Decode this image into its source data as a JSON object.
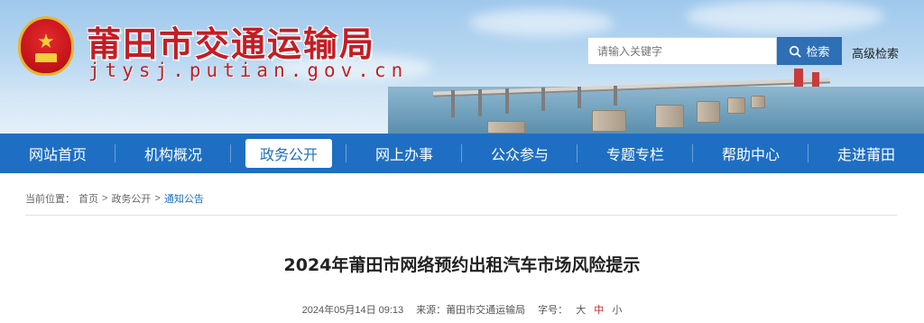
{
  "header": {
    "site_title": "莆田市交通运输局",
    "site_domain": "jtysj.putian.gov.cn",
    "search": {
      "placeholder": "请输入关键字",
      "button_label": "检索",
      "advanced_label": "高级检索"
    },
    "icons": [
      "national-emblem-icon",
      "search-icon"
    ]
  },
  "nav": {
    "items": [
      {
        "label": "网站首页",
        "active": false
      },
      {
        "label": "机构概况",
        "active": false
      },
      {
        "label": "政务公开",
        "active": true
      },
      {
        "label": "网上办事",
        "active": false
      },
      {
        "label": "公众参与",
        "active": false
      },
      {
        "label": "专题专栏",
        "active": false
      },
      {
        "label": "帮助中心",
        "active": false
      },
      {
        "label": "走进莆田",
        "active": false
      }
    ]
  },
  "breadcrumb": {
    "prefix": "当前位置：",
    "items": [
      "首页",
      "政务公开",
      "通知公告"
    ],
    "separator": ">"
  },
  "article": {
    "title": "2024年莆田市网络预约出租汽车市场风险提示",
    "date": "2024年05月14日 09:13",
    "source_label": "来源：",
    "source": "莆田市交通运输局",
    "font_size_label": "字号：",
    "font_sizes": [
      "大",
      "中",
      "小"
    ],
    "font_size_selected": "中"
  },
  "colors": {
    "brand_red": "#c41d24",
    "nav_blue": "#1e6fc3",
    "search_blue": "#2e6fb5"
  }
}
